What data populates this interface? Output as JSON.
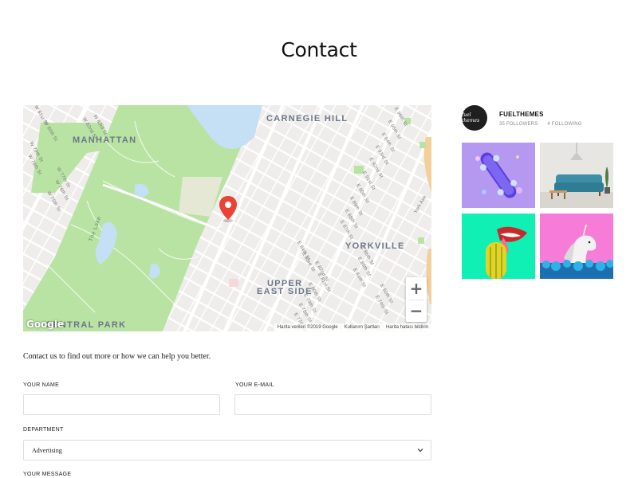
{
  "page": {
    "title": "Contact"
  },
  "map": {
    "neighborhoods": {
      "manhattan": "MANHATTAN",
      "carnegie_hill": "CARNEGIE HILL",
      "yorkville": "YORKVILLE",
      "upper_east_side_1": "UPPER",
      "upper_east_side_2": "EAST SIDE",
      "central_park": "CENTRAL PARK"
    },
    "park_label": "The Lake",
    "streets": {
      "w83": "W 83rd St",
      "w82": "W 82nd St",
      "w81": "W 81st St",
      "w80": "W 80th St",
      "w79": "W 79th St",
      "w78": "W 78th St",
      "w77": "W 77th St",
      "w76": "W 76th St",
      "w75": "W 75th St",
      "e96": "E 96th St",
      "e95": "E 95th St",
      "e94": "E 94th St",
      "e93": "E 93rd St",
      "e92": "E 92nd St",
      "e91": "E 91st St",
      "e90": "E 90th St",
      "e89": "E 89th St",
      "e88": "E 88th St",
      "e87": "E 87th St",
      "e84": "E 84th St",
      "e83": "E 83rd St",
      "e82": "E 82nd St",
      "e81": "E 81st St",
      "e80": "E 80th St",
      "e79": "E 79th St",
      "e78": "E 78th St",
      "e77": "E 77th St",
      "e76": "E 76th St",
      "e86b": "E 86th St",
      "e85b": "E 85th St",
      "e84b": "E 84th St",
      "e83b": "E 83rd St",
      "e82b": "E 82nd St",
      "e80b": "E 80th St",
      "e79b": "E 79th St",
      "e78b": "E 78th St",
      "york": "York Ave"
    },
    "zoom_in": "+",
    "zoom_out": "−",
    "logo": "Google",
    "attribution": [
      "Harita verileri ©2019 Google",
      "Kullanım Şartları",
      "Harita hatası bildirin"
    ],
    "colors": {
      "park": "#b9e3a3",
      "water": "#c5dff5",
      "road": "#ffffff",
      "block": "#eeecea",
      "pin": "#ea4335"
    }
  },
  "form": {
    "intro": "Contact us to find out more or how we can help you better.",
    "name_label": "YOUR NAME",
    "email_label": "YOUR E-MAIL",
    "department_label": "DEPARTMENT",
    "department_value": "Advertising",
    "message_label": "YOUR MESSAGE"
  },
  "instagram": {
    "username": "FUELTHEMES",
    "avatar_text": "fuel themes",
    "followers": "35 FOLLOWERS",
    "following": "4 FOLLOWING",
    "photo_colors": [
      "#b598f0",
      "#e7e6e3",
      "#11f0b4",
      "#f77cd8"
    ]
  }
}
